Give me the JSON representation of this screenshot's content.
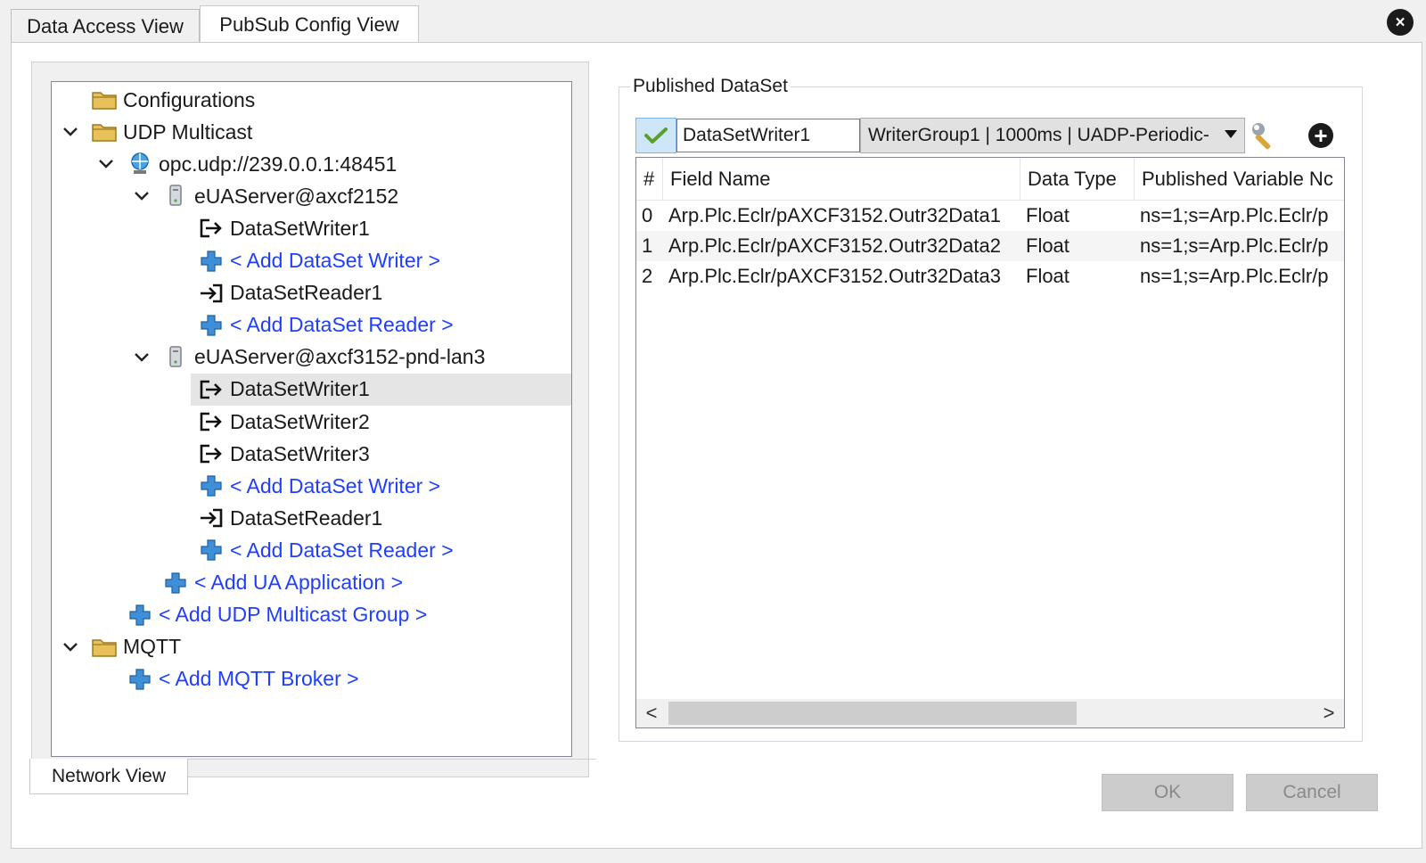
{
  "tabs": [
    {
      "label": "Data Access View"
    },
    {
      "label": "PubSub Config View"
    }
  ],
  "close_label": "×",
  "network_tab": "Network View",
  "tree": [
    {
      "label": "Configurations",
      "icon": "folder-icon",
      "level": 0,
      "link": false,
      "expanded": null,
      "selected": false
    },
    {
      "label": "UDP Multicast",
      "icon": "folder-icon",
      "level": 0,
      "link": false,
      "expanded": true,
      "selected": false
    },
    {
      "label": "opc.udp://239.0.0.1:48451",
      "icon": "network-globe-icon",
      "level": 1,
      "link": false,
      "expanded": true,
      "selected": false
    },
    {
      "label": "eUAServer@axcf2152",
      "icon": "server-icon",
      "level": 2,
      "link": false,
      "expanded": true,
      "selected": false
    },
    {
      "label": "DataSetWriter1",
      "icon": "writer-arrow-icon",
      "level": 3,
      "link": false,
      "expanded": null,
      "selected": false
    },
    {
      "label": "< Add DataSet Writer >",
      "icon": "plus-icon",
      "level": 3,
      "link": true,
      "expanded": null,
      "selected": false
    },
    {
      "label": "DataSetReader1",
      "icon": "reader-arrow-icon",
      "level": 3,
      "link": false,
      "expanded": null,
      "selected": false
    },
    {
      "label": "< Add DataSet Reader >",
      "icon": "plus-icon",
      "level": 3,
      "link": true,
      "expanded": null,
      "selected": false
    },
    {
      "label": "eUAServer@axcf3152-pnd-lan3",
      "icon": "server-icon",
      "level": 2,
      "link": false,
      "expanded": true,
      "selected": false
    },
    {
      "label": "DataSetWriter1",
      "icon": "writer-arrow-icon",
      "level": 3,
      "link": false,
      "expanded": null,
      "selected": true
    },
    {
      "label": "DataSetWriter2",
      "icon": "writer-arrow-icon",
      "level": 3,
      "link": false,
      "expanded": null,
      "selected": false
    },
    {
      "label": "DataSetWriter3",
      "icon": "writer-arrow-icon",
      "level": 3,
      "link": false,
      "expanded": null,
      "selected": false
    },
    {
      "label": "< Add DataSet Writer >",
      "icon": "plus-icon",
      "level": 3,
      "link": true,
      "expanded": null,
      "selected": false
    },
    {
      "label": "DataSetReader1",
      "icon": "reader-arrow-icon",
      "level": 3,
      "link": false,
      "expanded": null,
      "selected": false
    },
    {
      "label": "< Add DataSet Reader >",
      "icon": "plus-icon",
      "level": 3,
      "link": true,
      "expanded": null,
      "selected": false
    },
    {
      "label": "< Add UA Application >",
      "icon": "plus-icon",
      "level": 2,
      "link": true,
      "expanded": null,
      "selected": false
    },
    {
      "label": "< Add UDP Multicast Group >",
      "icon": "plus-icon",
      "level": 1,
      "link": true,
      "expanded": null,
      "selected": false
    },
    {
      "label": "MQTT",
      "icon": "folder-icon",
      "level": 0,
      "link": false,
      "expanded": true,
      "selected": false
    },
    {
      "label": "< Add MQTT Broker >",
      "icon": "plus-icon",
      "level": 1,
      "link": true,
      "expanded": null,
      "selected": false
    }
  ],
  "dataset": {
    "legend": "Published DataSet",
    "writer_name": "DataSetWriter1",
    "writer_group": "WriterGroup1 | 1000ms | UADP-Periodic-",
    "columns": [
      "#",
      "Field Name",
      "Data Type",
      "Published Variable Nc"
    ],
    "rows": [
      {
        "index": "0",
        "field": "Arp.Plc.Eclr/pAXCF3152.Outr32Data1",
        "type": "Float",
        "variable": "ns=1;s=Arp.Plc.Eclr/p"
      },
      {
        "index": "1",
        "field": "Arp.Plc.Eclr/pAXCF3152.Outr32Data2",
        "type": "Float",
        "variable": "ns=1;s=Arp.Plc.Eclr/p"
      },
      {
        "index": "2",
        "field": "Arp.Plc.Eclr/pAXCF3152.Outr32Data3",
        "type": "Float",
        "variable": "ns=1;s=Arp.Plc.Eclr/p"
      }
    ],
    "scroll_left": "<",
    "scroll_right": ">"
  },
  "buttons": {
    "ok": "OK",
    "cancel": "Cancel"
  },
  "colors": {
    "link": "#1f3fff",
    "selection": "#e5e5e5",
    "plus": "#2f7fd4",
    "folder": "#e8c15a"
  }
}
